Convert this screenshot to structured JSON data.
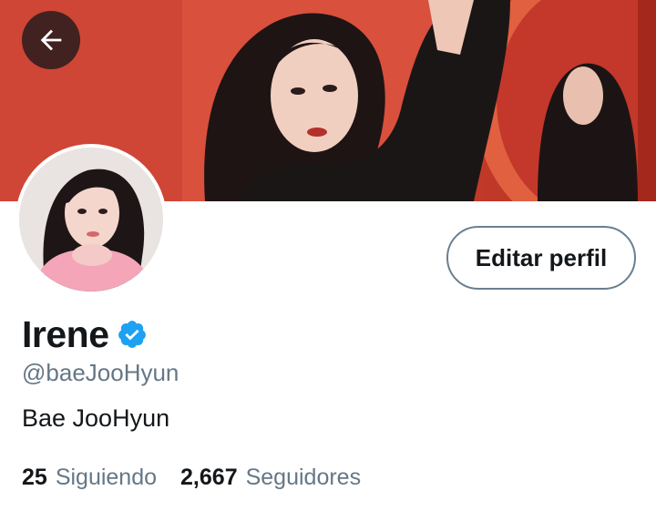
{
  "profile": {
    "name": "Irene",
    "handle": "@baeJooHyun",
    "bio": "Bae JooHyun",
    "verified": true
  },
  "actions": {
    "edit_label": "Editar perfil"
  },
  "stats": [
    {
      "count": "25",
      "label": "Siguiendo"
    },
    {
      "count": "2,667",
      "label": "Seguidores"
    }
  ],
  "icons": {
    "back": "arrow-left-icon",
    "verified": "verified-badge-icon"
  },
  "colors": {
    "banner": "#c4392c",
    "verified": "#1da1f2",
    "secondary_text": "#657786",
    "primary_text": "#14171a",
    "button_border": "#6b7f8f"
  }
}
